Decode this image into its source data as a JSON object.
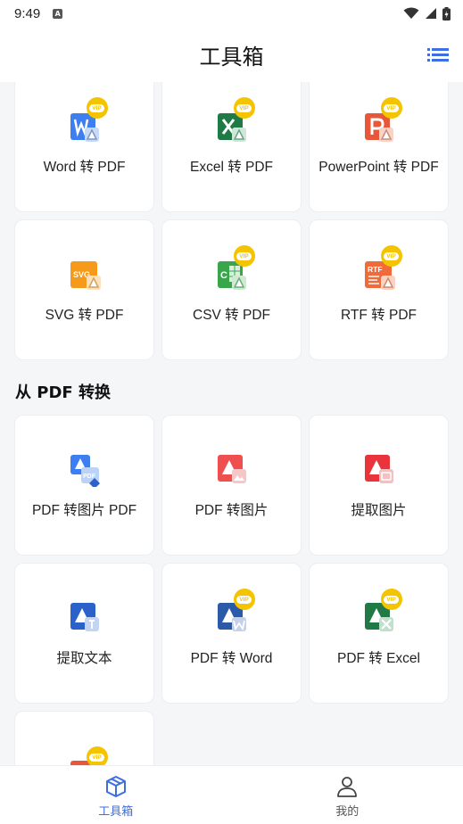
{
  "status_bar": {
    "time": "9:49"
  },
  "app_bar": {
    "title": "工具箱"
  },
  "to_pdf": {
    "tools": [
      {
        "label": "Word 转 PDF",
        "icon": "word-to-pdf-icon",
        "vip": true,
        "color": "#3d7ef0"
      },
      {
        "label": "Excel 转 PDF",
        "icon": "excel-to-pdf-icon",
        "vip": true,
        "color": "#1f7a45"
      },
      {
        "label": "PowerPoint 转 PDF",
        "icon": "ppt-to-pdf-icon",
        "vip": true,
        "color": "#e8573a"
      },
      {
        "label": "SVG 转 PDF",
        "icon": "svg-to-pdf-icon",
        "vip": false,
        "color": "#f59a1a"
      },
      {
        "label": "CSV 转 PDF",
        "icon": "csv-to-pdf-icon",
        "vip": true,
        "color": "#3aa64b"
      },
      {
        "label": "RTF 转 PDF",
        "icon": "rtf-to-pdf-icon",
        "vip": true,
        "color": "#f06a3a"
      }
    ]
  },
  "from_pdf": {
    "title": "从 PDF 转换",
    "tools": [
      {
        "label": "PDF 转图片 PDF",
        "icon": "pdf-to-image-pdf-icon",
        "vip": false,
        "color": "#3d7ef0"
      },
      {
        "label": "PDF 转图片",
        "icon": "pdf-to-image-icon",
        "vip": false,
        "color": "#ef4f4f"
      },
      {
        "label": "提取图片",
        "icon": "extract-images-icon",
        "vip": false,
        "color": "#e8343a"
      },
      {
        "label": "提取文本",
        "icon": "extract-text-icon",
        "vip": false,
        "color": "#2a62c9"
      },
      {
        "label": "PDF 转 Word",
        "icon": "pdf-to-word-icon",
        "vip": true,
        "color": "#2a5aa8"
      },
      {
        "label": "PDF 转 Excel",
        "icon": "pdf-to-excel-icon",
        "vip": true,
        "color": "#1f7a45"
      },
      {
        "label": "",
        "icon": "pdf-to-ppt-icon",
        "vip": true,
        "color": "#e8573a"
      }
    ]
  },
  "vip_badge": "VIP",
  "bottom_nav": {
    "items": [
      {
        "label": "工具箱",
        "icon": "toolbox-icon",
        "active": true
      },
      {
        "label": "我的",
        "icon": "profile-icon",
        "active": false
      }
    ]
  },
  "colors": {
    "accent": "#3d6fe0",
    "vip": "#f5c400"
  }
}
